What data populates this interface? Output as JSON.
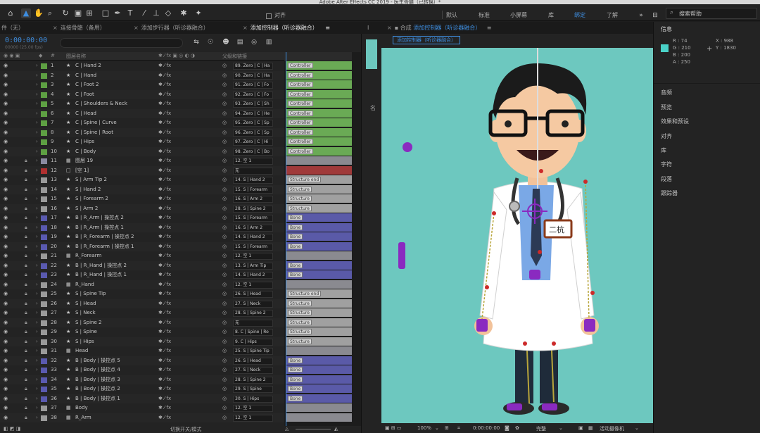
{
  "window": {
    "title": "Adobe After Effects CC 2019 - 医生骨骼（已转换）*"
  },
  "toolbar": {
    "align_label": "对齐",
    "workspaces": [
      "默认",
      "标准",
      "小屏幕",
      "库",
      "绑定",
      "了解"
    ],
    "active_workspace": "绑定",
    "search_help": "搜索帮助"
  },
  "panels": {
    "project_tab": "件（无）",
    "tab_chain": "连接骨骼（备用）",
    "tab_steps": "添加步行器（听诊器融合）",
    "timeline_tab": "添加控制器（听诊器融合）",
    "comp_label": "合成",
    "comp_name": "添加控制器（听诊器融合）",
    "comp_sub_tab": "添加控制器（听诊器融合）"
  },
  "timeline": {
    "current_time": "0:00:00:00",
    "fps_note": "00000 (25.00 fps)",
    "col_num": "#",
    "col_layer_name": "图层名称",
    "col_parent": "父级和链接",
    "switch_mode_label": "切换开关/模式",
    "layers": [
      {
        "num": "1",
        "name": "C | Hand 2",
        "parent": "89. Zero | C | Ha",
        "color": "#5ea043",
        "icon": "★",
        "bar": "Controller",
        "barcolor": "#6aaa55"
      },
      {
        "num": "2",
        "name": "C | Hand",
        "parent": "90. Zero | C | Ha",
        "color": "#5ea043",
        "icon": "★",
        "bar": "Controller",
        "barcolor": "#6aaa55"
      },
      {
        "num": "3",
        "name": "C | Foot 2",
        "parent": "91. Zero | C | Fo",
        "color": "#5ea043",
        "icon": "★",
        "bar": "Controller",
        "barcolor": "#6aaa55"
      },
      {
        "num": "4",
        "name": "C | Foot",
        "parent": "92. Zero | C | Fo",
        "color": "#5ea043",
        "icon": "★",
        "bar": "Controller",
        "barcolor": "#6aaa55"
      },
      {
        "num": "5",
        "name": "C | Shoulders & Neck",
        "parent": "93. Zero | C | Sh",
        "color": "#5ea043",
        "icon": "★",
        "bar": "Controller",
        "barcolor": "#6aaa55"
      },
      {
        "num": "6",
        "name": "C | Head",
        "parent": "94. Zero | C | He",
        "color": "#5ea043",
        "icon": "★",
        "bar": "Controller",
        "barcolor": "#6aaa55"
      },
      {
        "num": "7",
        "name": "C | Spine | Curve",
        "parent": "95. Zero | C | Sp",
        "color": "#5ea043",
        "icon": "★",
        "bar": "Controller",
        "barcolor": "#6aaa55"
      },
      {
        "num": "8",
        "name": "C | Spine | Root",
        "parent": "96. Zero | C | Sp",
        "color": "#5ea043",
        "icon": "★",
        "bar": "Controller",
        "barcolor": "#6aaa55"
      },
      {
        "num": "9",
        "name": "C | Hips",
        "parent": "97. Zero | C | Hi",
        "color": "#5ea043",
        "icon": "★",
        "bar": "Controller",
        "barcolor": "#6aaa55"
      },
      {
        "num": "10",
        "name": "C | Body",
        "parent": "98. Zero | C | Bo",
        "color": "#5ea043",
        "icon": "★",
        "bar": "Controller",
        "barcolor": "#6aaa55"
      },
      {
        "num": "11",
        "name": "图层 19",
        "parent": "12. 空 1",
        "color": "#8a8aa0",
        "icon": "▦",
        "bar": "",
        "barcolor": "#8a8a90"
      },
      {
        "num": "12",
        "name": "[空 1]",
        "parent": "无",
        "color": "#b03030",
        "icon": "□",
        "bar": "",
        "barcolor": "#a03a3a"
      },
      {
        "num": "13",
        "name": "S | Arm Tip 2",
        "parent": "14. S | Hand 2",
        "color": "#9a9a9a",
        "icon": "★",
        "bar": "Structure end",
        "barcolor": "#a0a0a0"
      },
      {
        "num": "14",
        "name": "S | Hand 2",
        "parent": "15. S | Forearm",
        "color": "#9a9a9a",
        "icon": "★",
        "bar": "Structure",
        "barcolor": "#a0a0a0"
      },
      {
        "num": "15",
        "name": "S | Forearm 2",
        "parent": "16. S | Arm 2",
        "color": "#9a9a9a",
        "icon": "★",
        "bar": "Structure",
        "barcolor": "#a0a0a0"
      },
      {
        "num": "16",
        "name": "S | Arm 2",
        "parent": "28. S | Spine 2",
        "color": "#9a9a9a",
        "icon": "★",
        "bar": "Structure",
        "barcolor": "#a0a0a0"
      },
      {
        "num": "17",
        "name": "B | R_Arm | 操控点 2",
        "parent": "15. S | Forearm",
        "color": "#5a5ab0",
        "icon": "★",
        "bar": "Bone",
        "barcolor": "#5a5aa8"
      },
      {
        "num": "18",
        "name": "B | R_Arm | 操控点 1",
        "parent": "16. S | Arm 2",
        "color": "#5a5ab0",
        "icon": "★",
        "bar": "Bone",
        "barcolor": "#5a5aa8"
      },
      {
        "num": "19",
        "name": "B | R_Forearm | 操控点 2",
        "parent": "14. S | Hand 2",
        "color": "#5a5ab0",
        "icon": "★",
        "bar": "Bone",
        "barcolor": "#5a5aa8"
      },
      {
        "num": "20",
        "name": "B | R_Forearm | 操控点 1",
        "parent": "15. S | Forearm",
        "color": "#5a5ab0",
        "icon": "★",
        "bar": "Bone",
        "barcolor": "#5a5aa8"
      },
      {
        "num": "21",
        "name": "R_Forearm",
        "parent": "12. 空 1",
        "color": "#9a9a9a",
        "icon": "▦",
        "bar": "",
        "barcolor": "#8a8a90"
      },
      {
        "num": "22",
        "name": "B | R_Hand | 操控点 2",
        "parent": "13. S | Arm Tip",
        "color": "#5a5ab0",
        "icon": "★",
        "bar": "Bone",
        "barcolor": "#5a5aa8"
      },
      {
        "num": "23",
        "name": "B | R_Hand | 操控点 1",
        "parent": "14. S | Hand 2",
        "color": "#5a5ab0",
        "icon": "★",
        "bar": "Bone",
        "barcolor": "#5a5aa8"
      },
      {
        "num": "24",
        "name": "R_Hand",
        "parent": "12. 空 1",
        "color": "#9a9a9a",
        "icon": "▦",
        "bar": "",
        "barcolor": "#8a8a90"
      },
      {
        "num": "25",
        "name": "S | Spine Tip",
        "parent": "26. S | Head",
        "color": "#9a9a9a",
        "icon": "★",
        "bar": "Structure end",
        "barcolor": "#a0a0a0"
      },
      {
        "num": "26",
        "name": "S | Head",
        "parent": "27. S | Neck",
        "color": "#9a9a9a",
        "icon": "★",
        "bar": "Structure",
        "barcolor": "#a0a0a0"
      },
      {
        "num": "27",
        "name": "S | Neck",
        "parent": "28. S | Spine 2",
        "color": "#9a9a9a",
        "icon": "★",
        "bar": "Structure",
        "barcolor": "#a0a0a0"
      },
      {
        "num": "28",
        "name": "S | Spine 2",
        "parent": "无",
        "color": "#9a9a9a",
        "icon": "★",
        "bar": "Structure",
        "barcolor": "#a0a0a0"
      },
      {
        "num": "29",
        "name": "S | Spine",
        "parent": "8. C | Spine | Ro",
        "color": "#9a9a9a",
        "icon": "★",
        "bar": "Structure",
        "barcolor": "#a0a0a0"
      },
      {
        "num": "30",
        "name": "S | Hips",
        "parent": "9. C | Hips",
        "color": "#9a9a9a",
        "icon": "★",
        "bar": "Structure",
        "barcolor": "#a0a0a0"
      },
      {
        "num": "31",
        "name": "Head",
        "parent": "25. S | Spine Tip",
        "color": "#9a9a9a",
        "icon": "▦",
        "bar": "",
        "barcolor": "#8a8a90"
      },
      {
        "num": "32",
        "name": "B | Body | 操控点 5",
        "parent": "26. S | Head",
        "color": "#5a5ab0",
        "icon": "★",
        "bar": "Bone",
        "barcolor": "#5a5aa8"
      },
      {
        "num": "33",
        "name": "B | Body | 操控点 4",
        "parent": "27. S | Neck",
        "color": "#5a5ab0",
        "icon": "★",
        "bar": "Bone",
        "barcolor": "#5a5aa8"
      },
      {
        "num": "34",
        "name": "B | Body | 操控点 3",
        "parent": "28. S | Spine 2",
        "color": "#5a5ab0",
        "icon": "★",
        "bar": "Bone",
        "barcolor": "#5a5aa8"
      },
      {
        "num": "35",
        "name": "B | Body | 操控点 2",
        "parent": "29. S | Spine",
        "color": "#5a5ab0",
        "icon": "★",
        "bar": "Bone",
        "barcolor": "#5a5aa8"
      },
      {
        "num": "36",
        "name": "B | Body | 操控点 1",
        "parent": "30. S | Hips",
        "color": "#5a5ab0",
        "icon": "★",
        "bar": "Bone",
        "barcolor": "#5a5aa8"
      },
      {
        "num": "37",
        "name": "Body",
        "parent": "12. 空 1",
        "color": "#9a9a9a",
        "icon": "▦",
        "bar": "",
        "barcolor": "#8a8a90"
      },
      {
        "num": "38",
        "name": "R_Arm",
        "parent": "12. 空 1",
        "color": "#9a9a9a",
        "icon": "▦",
        "bar": "",
        "barcolor": "#8a8a90"
      }
    ]
  },
  "comp_footer": {
    "zoom": "100%",
    "time": "0:00:00:00",
    "quality": "完整",
    "camera": "活动摄像机"
  },
  "info": {
    "title": "信息",
    "r": "R : 74",
    "g": "G : 210",
    "b": "B : 200",
    "a": "A : 250",
    "x": "X : 988",
    "y": "Y : 1830",
    "sections": [
      "音频",
      "预览",
      "效果和预设",
      "对齐",
      "库",
      "字符",
      "段落",
      "跟踪器"
    ]
  },
  "canvas": {
    "badge_text": "二杭",
    "background": "#6dc8bf"
  }
}
